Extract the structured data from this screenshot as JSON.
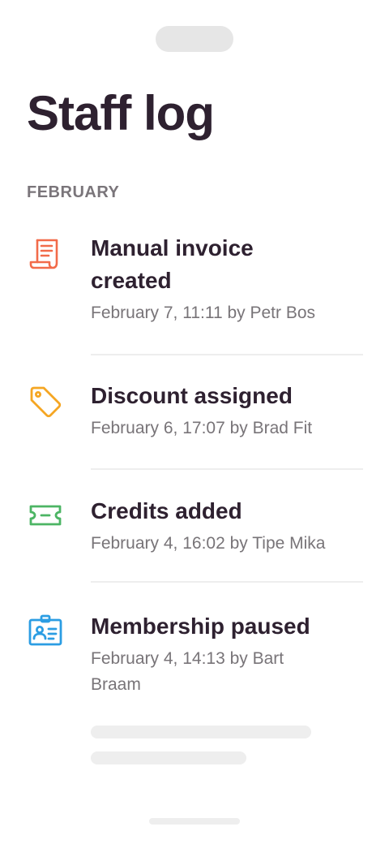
{
  "page": {
    "title": "Staff log"
  },
  "section": {
    "label": "FEBRUARY"
  },
  "entries": [
    {
      "title_line1": "Manual invoice",
      "title_line2": "created",
      "meta": "February 7, 11:11 by Petr Bos",
      "icon": "receipt-icon",
      "color": "#f26b4a"
    },
    {
      "title": "Discount assigned",
      "meta": "February 6, 17:07 by Brad Fit",
      "icon": "tag-icon",
      "color": "#f5a623"
    },
    {
      "title": "Credits added",
      "meta": "February 4, 16:02 by Tipe Mika",
      "icon": "ticket-icon",
      "color": "#4cb564"
    },
    {
      "title": "Membership paused",
      "meta_line1": "February 4, 14:13 by Bart",
      "meta_line2": "Braam",
      "icon": "member-card-icon",
      "color": "#2b9de3"
    }
  ]
}
